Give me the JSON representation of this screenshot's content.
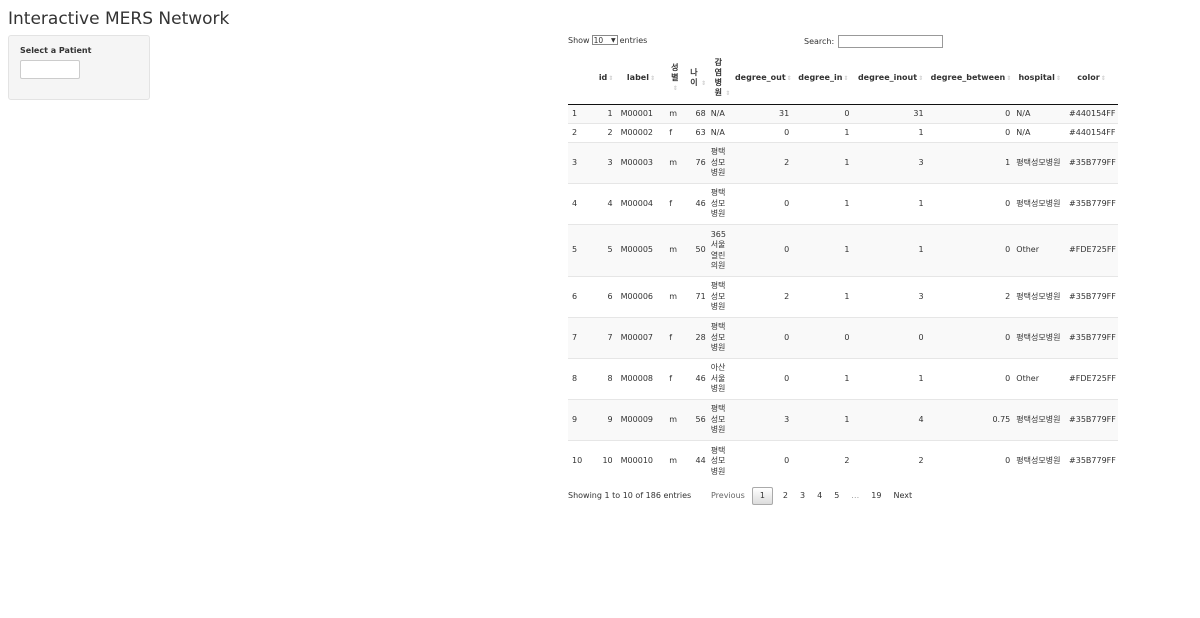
{
  "title": "Interactive MERS Network",
  "sidebar": {
    "label": "Select a Patient",
    "input_value": ""
  },
  "table_controls": {
    "show_label": "Show",
    "length_value": "10",
    "entries_label": "entries",
    "search_label": "Search:",
    "search_value": ""
  },
  "columns": [
    "",
    "id",
    "label",
    "성별",
    "나이",
    "감염병원",
    "degree_out",
    "degree_in",
    "degree_inout",
    "degree_between",
    "hospital",
    "color"
  ],
  "rows": [
    {
      "rn": "1",
      "id": "1",
      "label": "M00001",
      "sex": "m",
      "age": "68",
      "inf": "N/A",
      "dout": "31",
      "din": "0",
      "dio": "31",
      "dbet": "0",
      "hospital": "N/A",
      "color": "#440154FF"
    },
    {
      "rn": "2",
      "id": "2",
      "label": "M00002",
      "sex": "f",
      "age": "63",
      "inf": "N/A",
      "dout": "0",
      "din": "1",
      "dio": "1",
      "dbet": "0",
      "hospital": "N/A",
      "color": "#440154FF"
    },
    {
      "rn": "3",
      "id": "3",
      "label": "M00003",
      "sex": "m",
      "age": "76",
      "inf": "평택성모병원",
      "dout": "2",
      "din": "1",
      "dio": "3",
      "dbet": "1",
      "hospital": "평택성모병원",
      "color": "#35B779FF"
    },
    {
      "rn": "4",
      "id": "4",
      "label": "M00004",
      "sex": "f",
      "age": "46",
      "inf": "평택성모병원",
      "dout": "0",
      "din": "1",
      "dio": "1",
      "dbet": "0",
      "hospital": "평택성모병원",
      "color": "#35B779FF"
    },
    {
      "rn": "5",
      "id": "5",
      "label": "M00005",
      "sex": "m",
      "age": "50",
      "inf": "365서울열린의원",
      "dout": "0",
      "din": "1",
      "dio": "1",
      "dbet": "0",
      "hospital": "Other",
      "color": "#FDE725FF"
    },
    {
      "rn": "6",
      "id": "6",
      "label": "M00006",
      "sex": "m",
      "age": "71",
      "inf": "평택성모병원",
      "dout": "2",
      "din": "1",
      "dio": "3",
      "dbet": "2",
      "hospital": "평택성모병원",
      "color": "#35B779FF"
    },
    {
      "rn": "7",
      "id": "7",
      "label": "M00007",
      "sex": "f",
      "age": "28",
      "inf": "평택성모병원",
      "dout": "0",
      "din": "0",
      "dio": "0",
      "dbet": "0",
      "hospital": "평택성모병원",
      "color": "#35B779FF"
    },
    {
      "rn": "8",
      "id": "8",
      "label": "M00008",
      "sex": "f",
      "age": "46",
      "inf": "아산서울병원",
      "dout": "0",
      "din": "1",
      "dio": "1",
      "dbet": "0",
      "hospital": "Other",
      "color": "#FDE725FF"
    },
    {
      "rn": "9",
      "id": "9",
      "label": "M00009",
      "sex": "m",
      "age": "56",
      "inf": "평택성모병원",
      "dout": "3",
      "din": "1",
      "dio": "4",
      "dbet": "0.75",
      "hospital": "평택성모병원",
      "color": "#35B779FF"
    },
    {
      "rn": "10",
      "id": "10",
      "label": "M00010",
      "sex": "m",
      "age": "44",
      "inf": "평택성모병원",
      "dout": "0",
      "din": "2",
      "dio": "2",
      "dbet": "0",
      "hospital": "평택성모병원",
      "color": "#35B779FF"
    }
  ],
  "footer": {
    "info": "Showing 1 to 10 of 186 entries",
    "previous": "Previous",
    "pages": [
      "1",
      "2",
      "3",
      "4",
      "5"
    ],
    "ellipsis": "…",
    "last_page": "19",
    "next": "Next",
    "current_page": "1"
  }
}
